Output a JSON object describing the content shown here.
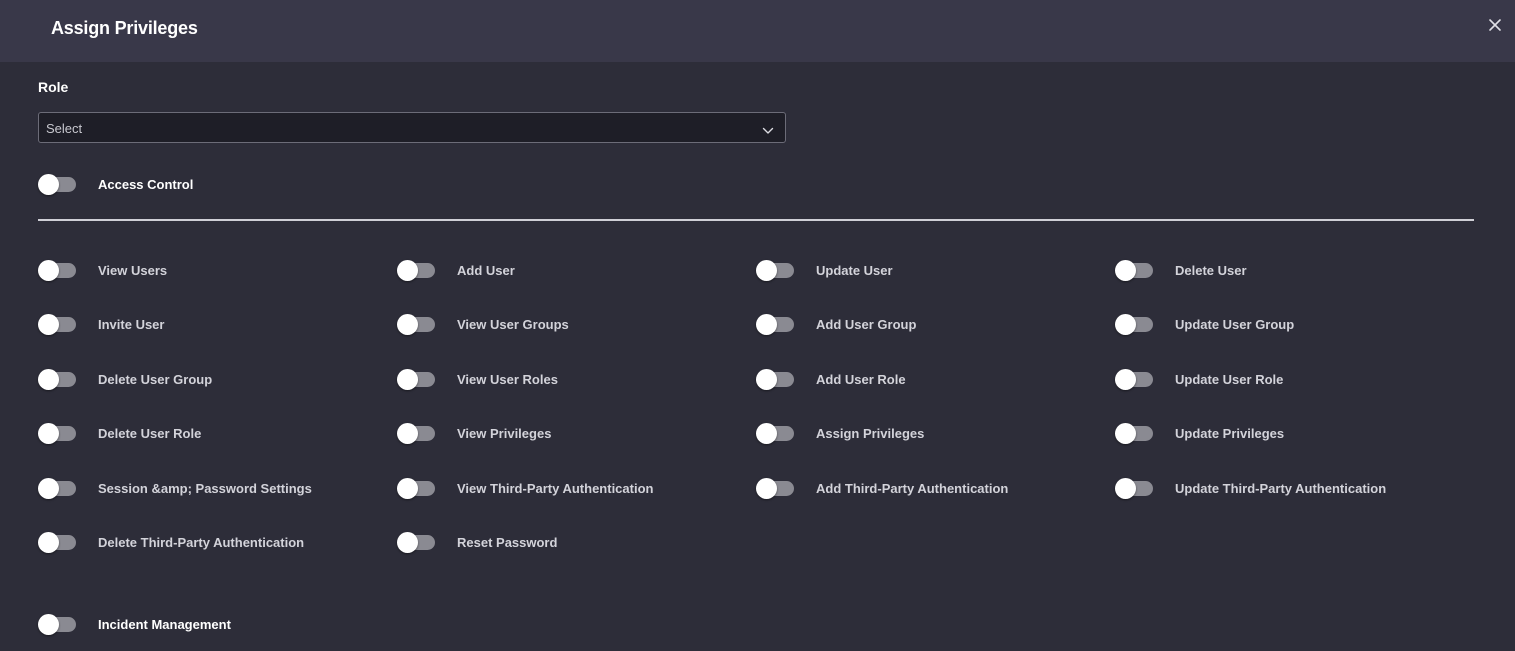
{
  "modal": {
    "title": "Assign Privileges",
    "close_icon": "close-icon"
  },
  "role": {
    "label": "Role",
    "select_value": "Select"
  },
  "sections": {
    "access_control": "Access Control",
    "incident_management": "Incident Management"
  },
  "permissions": [
    "View Users",
    "Add User",
    "Update User",
    "Delete User",
    "Invite User",
    "View User Groups",
    "Add User Group",
    "Update User Group",
    "Delete User Group",
    "View User Roles",
    "Add User Role",
    "Update User Role",
    "Delete User Role",
    "View Privileges",
    "Assign Privileges",
    "Update Privileges",
    "Session &amp; Password Settings",
    "View Third-Party Authentication",
    "Add Third-Party Authentication",
    "Update Third-Party Authentication",
    "Delete Third-Party Authentication",
    "Reset Password"
  ],
  "colors": {
    "header_bg": "#393849",
    "body_bg": "#2d2d39",
    "select_bg": "#1e1e27",
    "toggle_track_off": "#8a8a92"
  }
}
